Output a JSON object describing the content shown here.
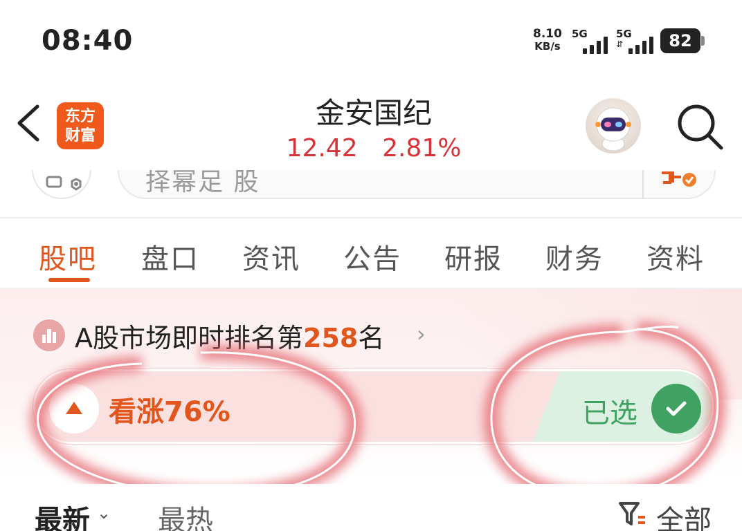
{
  "status_bar": {
    "time": "08:40",
    "net_speed_value": "8.10",
    "net_speed_unit": "KB/s",
    "signal1_label": "5G",
    "signal2_label": "5G",
    "battery": "82"
  },
  "header": {
    "logo_line1": "东方",
    "logo_line2": "财富",
    "stock_name": "金安国纪",
    "price": "12.42",
    "change_pct": "2.81%"
  },
  "search_strip": {
    "placeholder_partial": "择幂足 股"
  },
  "tabs": [
    {
      "label": "股吧",
      "active": true
    },
    {
      "label": "盘口",
      "active": false
    },
    {
      "label": "资讯",
      "active": false
    },
    {
      "label": "公告",
      "active": false
    },
    {
      "label": "研报",
      "active": false
    },
    {
      "label": "财务",
      "active": false
    },
    {
      "label": "资料",
      "active": false
    }
  ],
  "sentiment": {
    "rank_prefix": "A股市场即时排名第",
    "rank_number": "258",
    "rank_suffix": "名",
    "bullish_label": "看涨76%",
    "bullish_fraction": 0.76,
    "picked_label": "已选"
  },
  "sort_bar": {
    "latest": "最新",
    "hottest": "最热",
    "filter_label": "全部"
  },
  "colors": {
    "accent": "#e0561c",
    "price_red": "#d9333a",
    "picked_green": "#3fa262"
  }
}
